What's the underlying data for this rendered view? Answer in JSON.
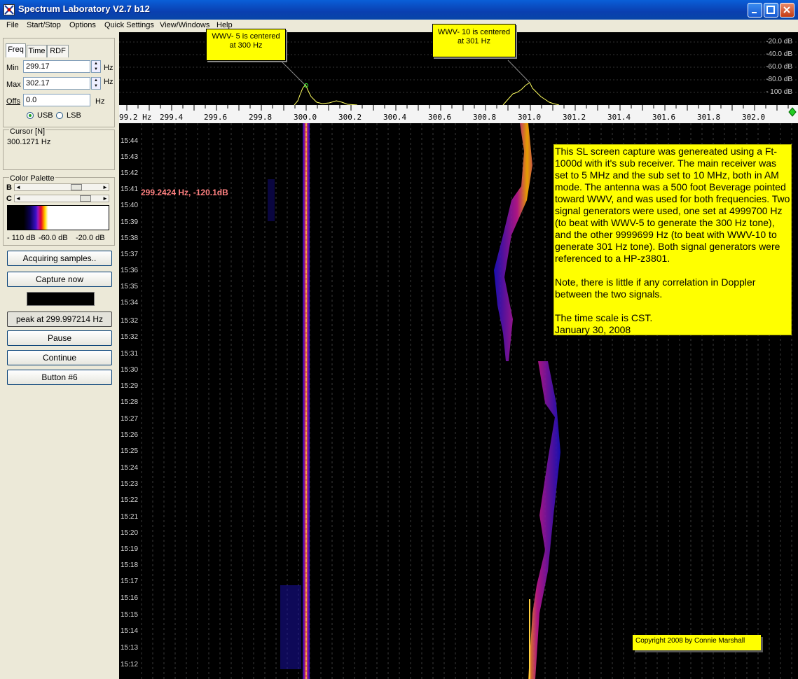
{
  "window": {
    "title": "Spectrum Laboratory V2.7 b12",
    "controls": [
      "minimize-icon",
      "maximize-icon",
      "close-icon"
    ]
  },
  "menu": [
    "File",
    "Start/Stop",
    "Options",
    "Quick Settings",
    "View/Windows",
    "Help"
  ],
  "tabs": [
    "Freq",
    "Time",
    "RDF"
  ],
  "freq_panel": {
    "min_label": "Min",
    "min_value": "299.17",
    "min_unit": "Hz",
    "max_label": "Max",
    "max_value": "302.17",
    "max_unit": "Hz",
    "offs_label": "Offs",
    "offs_value": "0.0",
    "offs_unit": "Hz",
    "usb_label": "USB",
    "lsb_label": "LSB",
    "selected_sideband": "USB"
  },
  "cursor_panel": {
    "title": "Cursor [N]",
    "value": "300.1271 Hz"
  },
  "color_palette": {
    "title": "Color Palette",
    "b_label": "B",
    "c_label": "C",
    "scale_labels": [
      "- 110 dB",
      "-60.0 dB",
      "-20.0 dB"
    ]
  },
  "buttons": {
    "acquiring": "Acquiring samples..",
    "capture": "Capture now",
    "peak": "peak at 299.997214 Hz",
    "pause": "Pause",
    "continue": "Continue",
    "button6": "Button #6"
  },
  "spectrum": {
    "db_labels": [
      "-20.0 dB",
      "-40.0 dB",
      "-60.0 dB",
      "-80.0 dB",
      "- 100 dB"
    ],
    "callout_left": [
      "WWV- 5 is centered",
      "at 300 Hz"
    ],
    "callout_right": [
      "WWV- 10 is centered",
      "at 301 Hz"
    ]
  },
  "freq_axis": {
    "labels": [
      "99.2 Hz",
      "299.4",
      "299.6",
      "299.8",
      "300.0",
      "300.2",
      "300.4",
      "300.6",
      "300.8",
      "301.0",
      "301.2",
      "301.4",
      "301.6",
      "301.8",
      "302.0"
    ]
  },
  "waterfall": {
    "cursor_readout": "299.2424 Hz, -120.1dB",
    "time_labels": [
      "15:44",
      "15:43",
      "15:42",
      "15:41",
      "15:40",
      "15:39",
      "15:38",
      "15:37",
      "15:36",
      "15:35",
      "15:34",
      "15:32",
      "15:32",
      "15:31",
      "15:30",
      "15:29",
      "15:28",
      "15:27",
      "15:26",
      "15:25",
      "15:24",
      "15:23",
      "15:22",
      "15:21",
      "15:20",
      "15:19",
      "15:18",
      "15:17",
      "15:16",
      "15:15",
      "15:14",
      "15:13",
      "15:12"
    ],
    "note_paragraphs": [
      "This SL screen capture was genereated using a Ft-1000d with it's sub receiver. The main receiver was set to 5 MHz and the sub set to 10 MHz, both in AM mode. The antenna was a 500 foot Beverage pointed toward WWV, and was used for both frequencies. Two signal generators were used, one set at 4999700 Hz (to beat with WWV-5 to generate the 300 Hz tone), and the other 9999699 Hz (to beat with WWV-10 to generate 301 Hz tone).  Both signal generators were referenced to a HP-z3801.",
      "Note, there is little if any correlation in Doppler between the two signals.",
      "The time scale is CST."
    ],
    "date_line": "January 30, 2008",
    "copyright": "Copyright 2008 by Connie Marshall"
  }
}
